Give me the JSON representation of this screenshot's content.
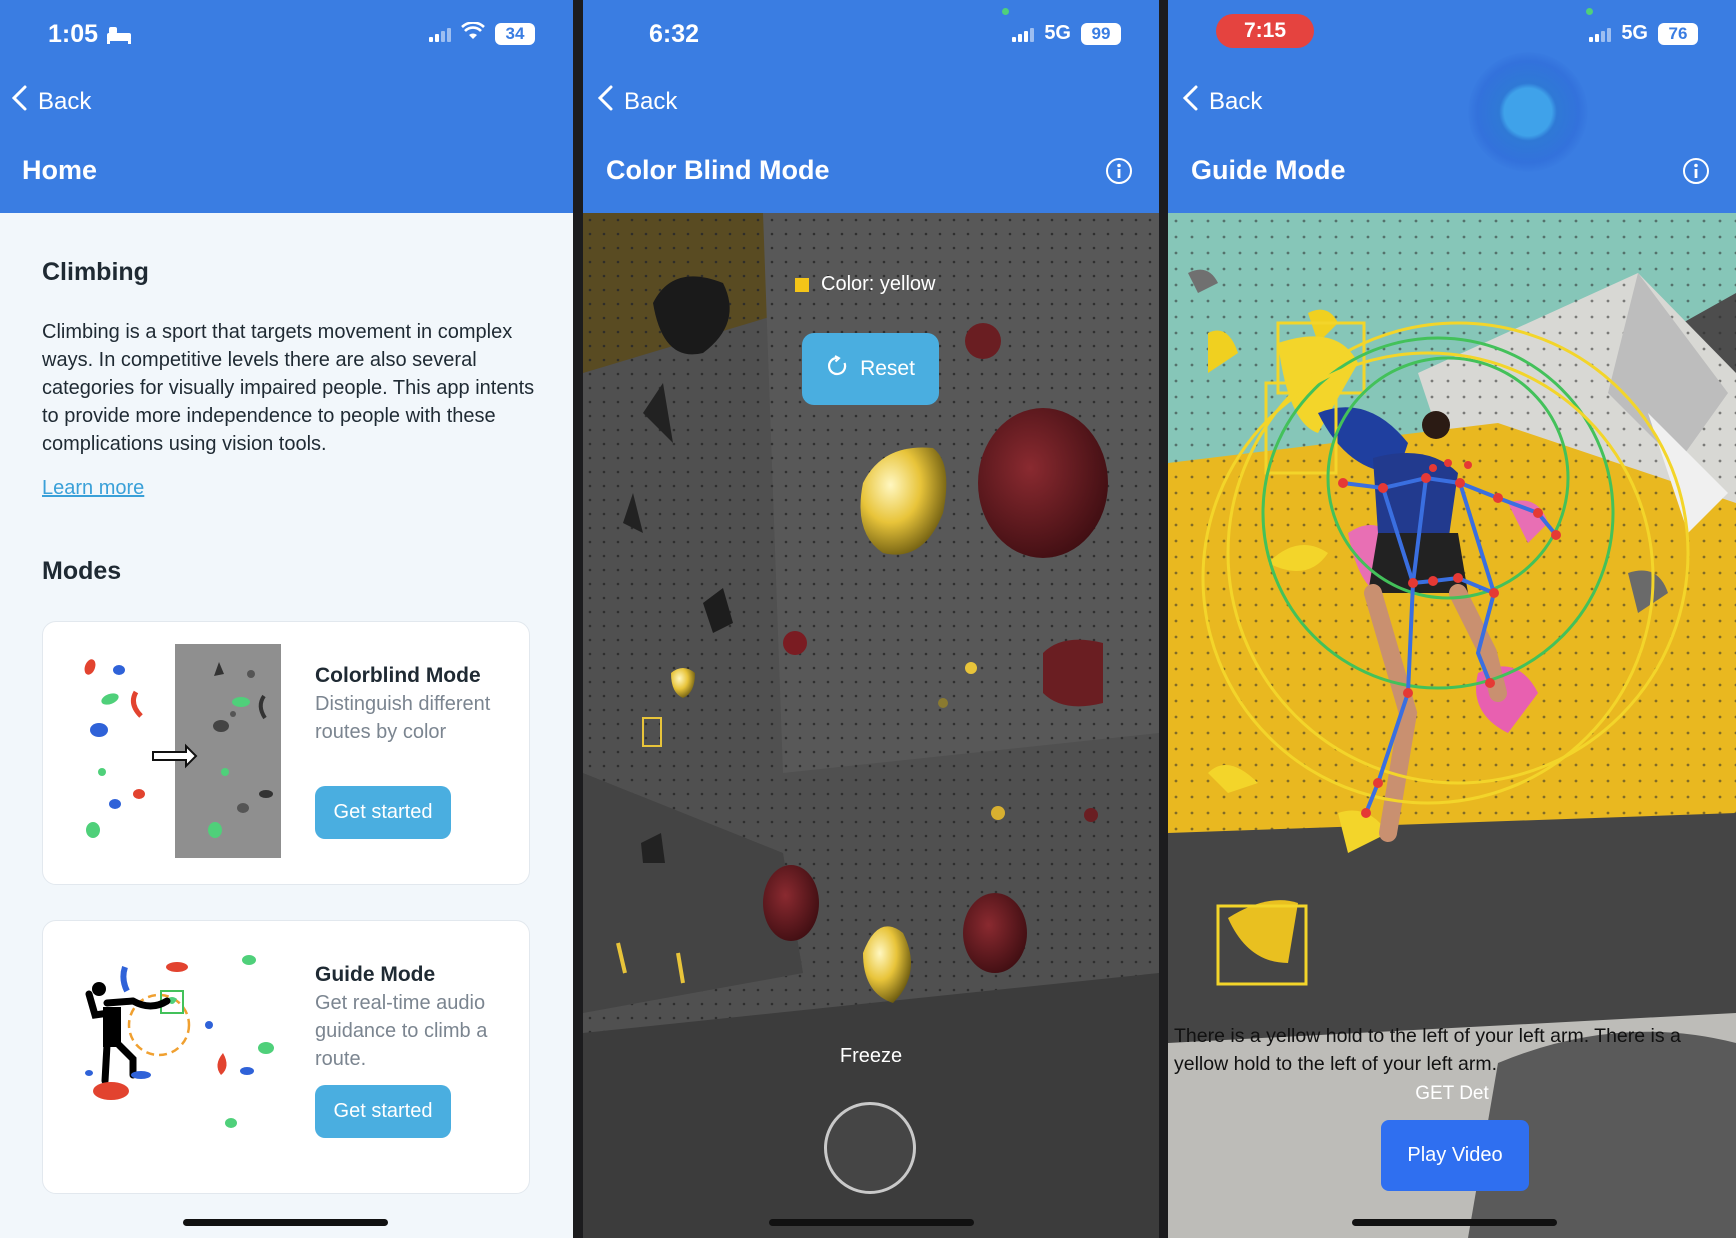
{
  "screens": {
    "home": {
      "status": {
        "time": "1:05",
        "battery": "34"
      },
      "back_label": "Back",
      "title": "Home",
      "section_title": "Climbing",
      "description": "Climbing is a sport that targets movement in complex ways. In competitive levels there are also several categories for visually impaired people. This app intents to provide more independence to people with these complications using vision tools.",
      "learn_more": "Learn more",
      "modes_title": "Modes",
      "modes": [
        {
          "title": "Colorblind Mode",
          "description": "Distinguish different routes by color",
          "button": "Get started",
          "icon": "colorblind-illustration"
        },
        {
          "title": "Guide Mode",
          "description": "Get real-time audio guidance to climb a route.",
          "button": "Get started",
          "icon": "guide-illustration"
        }
      ]
    },
    "colorblind": {
      "status": {
        "time": "6:32",
        "network": "5G",
        "battery": "99"
      },
      "back_label": "Back",
      "title": "Color Blind Mode",
      "color_label": "Color: yellow",
      "reset_label": "Reset",
      "freeze_label": "Freeze"
    },
    "guide": {
      "status": {
        "time": "7:15",
        "network": "5G",
        "battery": "76"
      },
      "back_label": "Back",
      "title": "Guide Mode",
      "guidance_text": "There is a yellow hold to the left of your left arm. There is a yellow hold to the left of your left arm.",
      "debug_label": "GET Det",
      "play_label": "Play Video"
    }
  },
  "colors": {
    "header_blue": "#3a7de2",
    "button_blue": "#4aaee0",
    "play_button": "#2f6ff0",
    "highlight_yellow": "#f5c518",
    "pose_line": "#3a6fe0",
    "pose_joint": "#e53935",
    "circle_green": "#43c15a"
  }
}
